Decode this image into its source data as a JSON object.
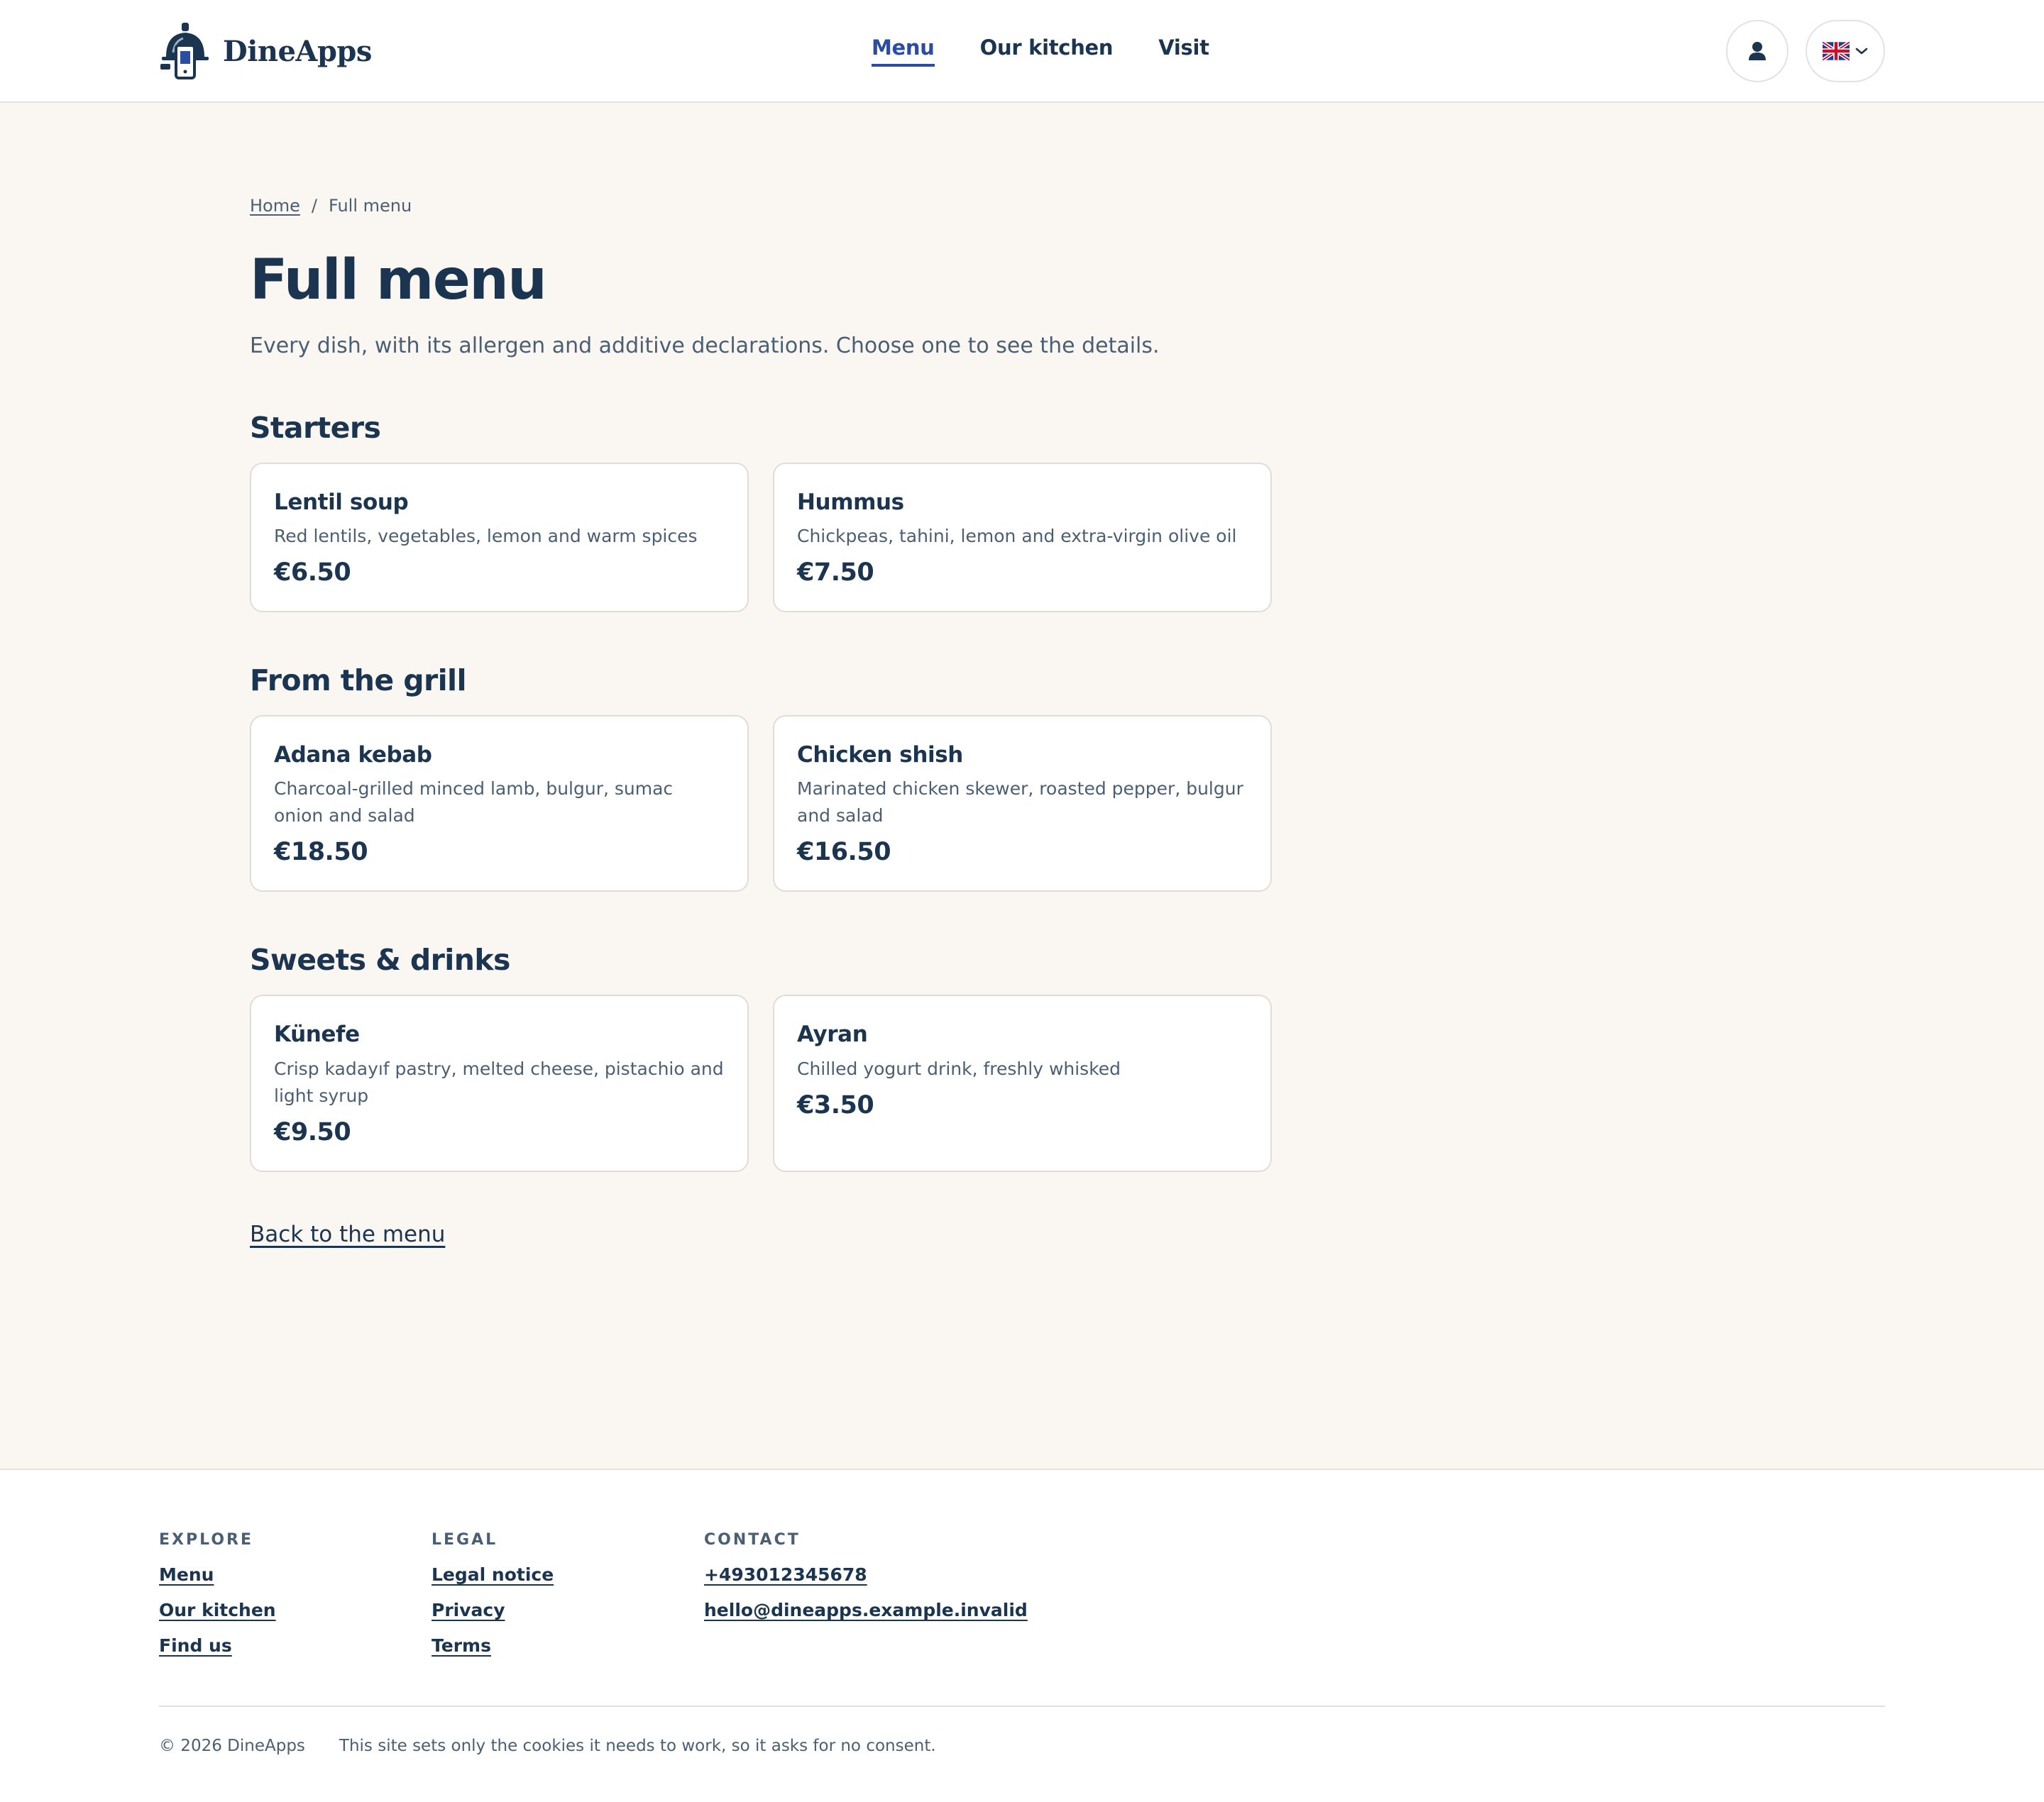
{
  "header": {
    "brand": "DineApps",
    "nav": [
      {
        "label": "Menu",
        "active": true
      },
      {
        "label": "Our kitchen",
        "active": false
      },
      {
        "label": "Visit",
        "active": false
      }
    ],
    "language_icon": "uk-flag-icon",
    "account_icon": "user-icon"
  },
  "breadcrumb": {
    "home": "Home",
    "separator": "/",
    "current": "Full menu"
  },
  "page": {
    "title": "Full menu",
    "intro": "Every dish, with its allergen and additive declarations. Choose one to see the details."
  },
  "sections": [
    {
      "title": "Starters",
      "dishes": [
        {
          "name": "Lentil soup",
          "description": "Red lentils, vegetables, lemon and warm spices",
          "price": "€6.50"
        },
        {
          "name": "Hummus",
          "description": "Chickpeas, tahini, lemon and extra-virgin olive oil",
          "price": "€7.50"
        }
      ]
    },
    {
      "title": "From the grill",
      "dishes": [
        {
          "name": "Adana kebab",
          "description": "Charcoal-grilled minced lamb, bulgur, sumac onion and salad",
          "price": "€18.50"
        },
        {
          "name": "Chicken shish",
          "description": "Marinated chicken skewer, roasted pepper, bulgur and salad",
          "price": "€16.50"
        }
      ]
    },
    {
      "title": "Sweets & drinks",
      "dishes": [
        {
          "name": "Künefe",
          "description": "Crisp kadayıf pastry, melted cheese, pistachio and light syrup",
          "price": "€9.50"
        },
        {
          "name": "Ayran",
          "description": "Chilled yogurt drink, freshly whisked",
          "price": "€3.50"
        }
      ]
    }
  ],
  "back_link": "Back to the menu",
  "footer": {
    "columns": [
      {
        "heading": "EXPLORE",
        "links": [
          "Menu",
          "Our kitchen",
          "Find us"
        ]
      },
      {
        "heading": "LEGAL",
        "links": [
          "Legal notice",
          "Privacy",
          "Terms"
        ]
      },
      {
        "heading": "CONTACT",
        "links": [
          "+493012345678",
          "hello@dineapps.example.invalid"
        ]
      }
    ],
    "copyright": "© 2026 DineApps",
    "cookie_note": "This site sets only the cookies it needs to work, so it asks for no consent."
  },
  "colors": {
    "primary_text": "#1b3550",
    "muted_text": "#4a5f73",
    "accent": "#2a4da3",
    "page_background": "#faf7f2",
    "card_background": "#ffffff"
  }
}
